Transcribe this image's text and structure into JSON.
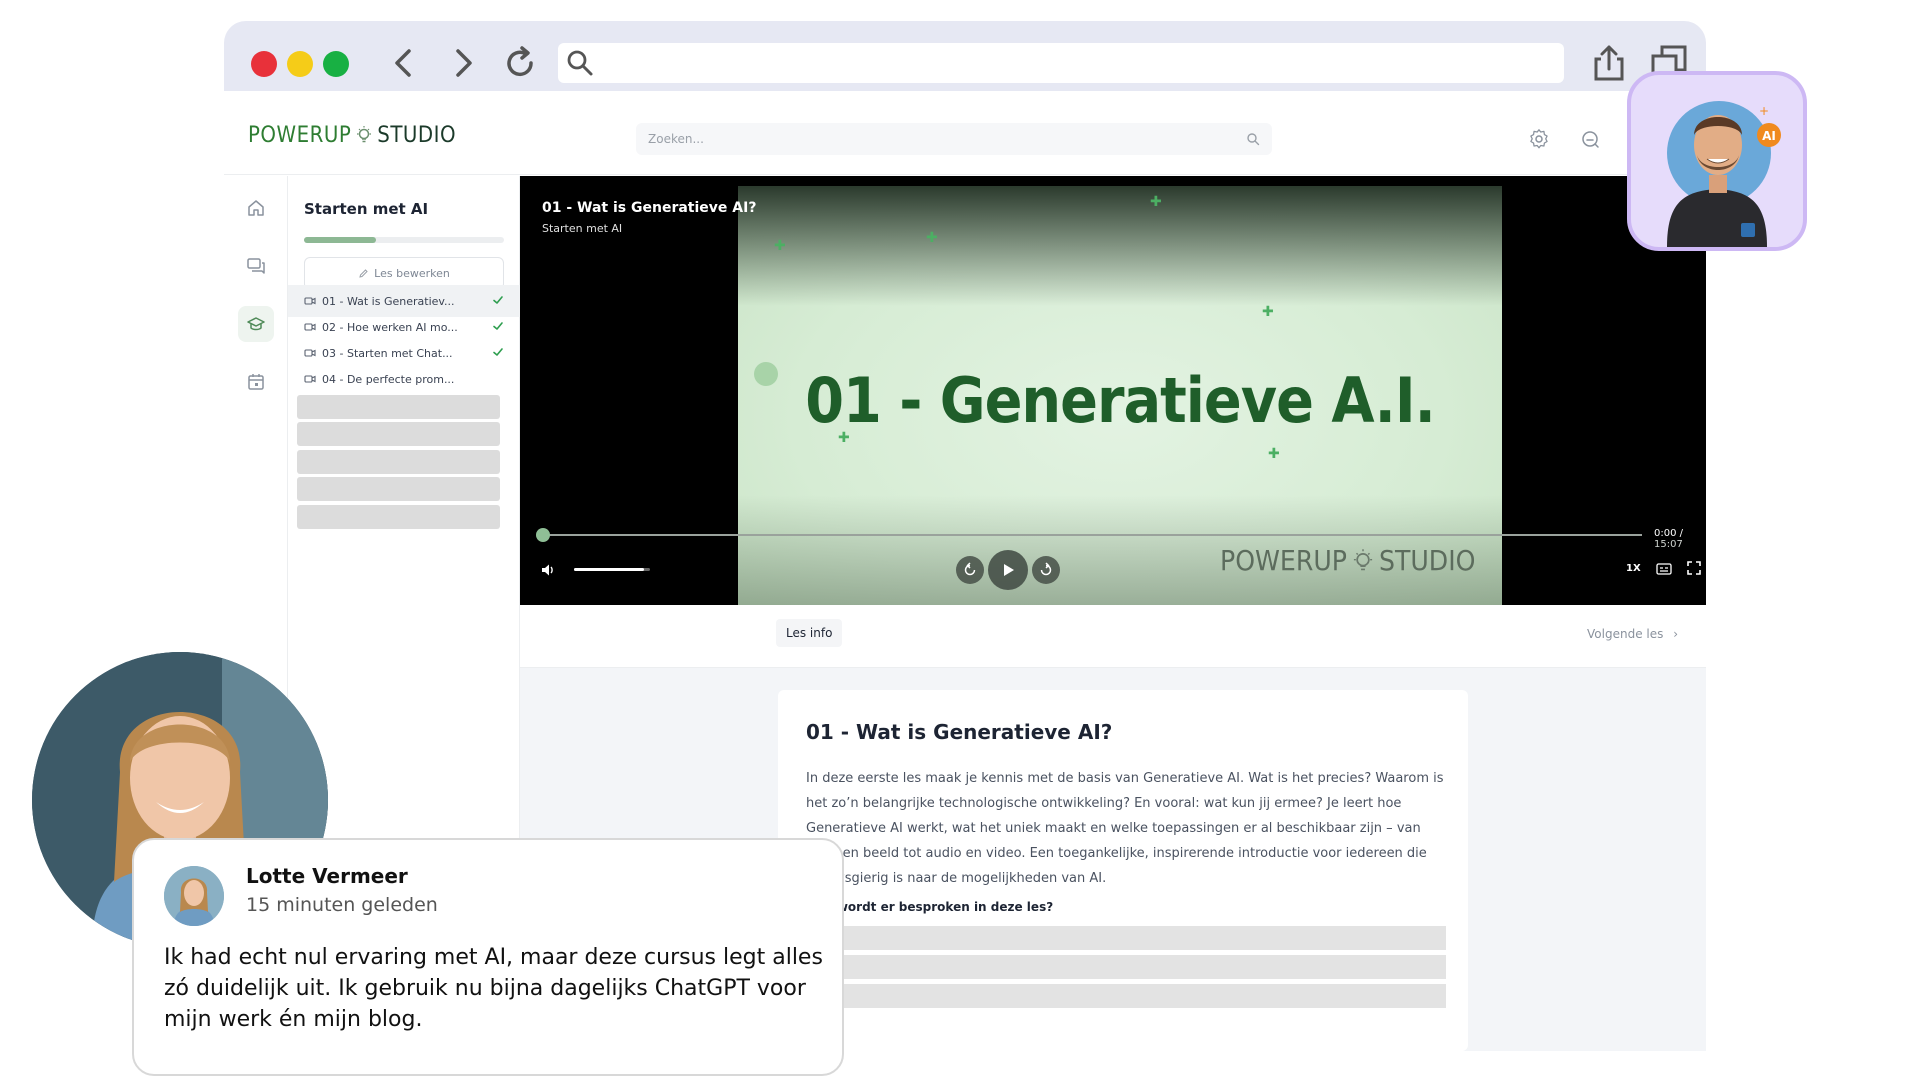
{
  "app": {
    "logo_left": "POWERUP",
    "logo_right": "STUDIO",
    "search_placeholder": "Zoeken..."
  },
  "course": {
    "title": "Starten met AI",
    "progress": 0.36,
    "edit_label": "Les bewerken"
  },
  "lessons": [
    {
      "label": "01 - Wat is Generatiev...",
      "done": true,
      "active": true
    },
    {
      "label": "02 - Hoe werken AI mo...",
      "done": true,
      "active": false
    },
    {
      "label": "03 - Starten met Chat...",
      "done": true,
      "active": false
    },
    {
      "label": "04 - De perfecte prom...",
      "done": false,
      "active": false
    }
  ],
  "video": {
    "title": "01 - Wat is Generatieve AI?",
    "subtitle": "Starten met AI",
    "slide_title": "01 - Generatieve A.I.",
    "slide_brand_left": "POWERUP",
    "slide_brand_right": "STUDIO",
    "current_time": "0:00",
    "separator": "/",
    "duration": "15:07",
    "speed": "1X",
    "progress": 0,
    "volume": 0.92
  },
  "tabs": {
    "info_label": "Les info",
    "next_label": "Volgende les"
  },
  "lesson_info": {
    "heading": "01 - Wat is Generatieve AI?",
    "body": "In deze eerste les maak je kennis met de basis van Generatieve AI. Wat is het precies? Waarom is het zo’n belangrijke technologische ontwikkeling? En vooral: wat kun jij ermee? Je leert hoe Generatieve AI werkt, wat het uniek maakt en welke toepassingen er al beschikbaar zijn – van tekst en beeld tot audio en video. Een toegankelijke, inspirerende introductie voor iedereen die nieuwsgierig is naar de mogelijkheden van AI.",
    "subheading": "Wat wordt er besproken in deze les?"
  },
  "testimonial": {
    "name": "Lotte Vermeer",
    "time": "15 minuten geleden",
    "text": "Ik had echt nul ervaring met AI, maar deze cursus legt alles zó duidelijk uit. Ik gebruik nu bijna dagelijks ChatGPT voor mijn werk én mijn blog."
  },
  "avatar_badge": "AI",
  "colors": {
    "brand_green": "#2e7d32",
    "check_green": "#2e9e4f",
    "accent_purple": "#cdb8f4"
  }
}
